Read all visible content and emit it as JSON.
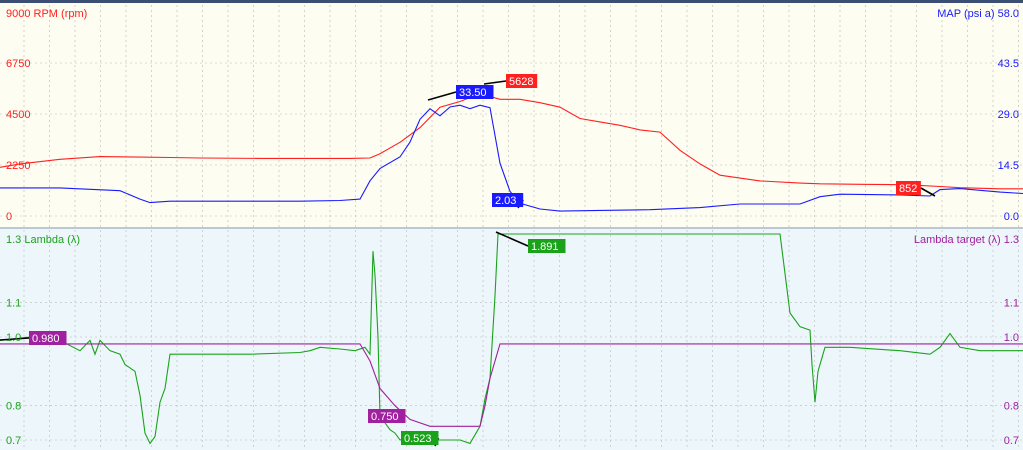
{
  "colors": {
    "rpm": "#ff2020",
    "map": "#1a1aff",
    "lambda": "#1aa31a",
    "lambda_target": "#a0209f",
    "marker": "#000000",
    "top_bg": "#fdfdf2",
    "bottom_bg": "#edf7fb",
    "grid": "#b8b8b8"
  },
  "chart_data": [
    {
      "type": "line",
      "axes": {
        "left": {
          "label": "9000 RPM (rpm)",
          "ticks": [
            "6750",
            "4500",
            "2250",
            "0"
          ],
          "range": [
            0,
            9000
          ]
        },
        "right": {
          "label": "MAP (psi a) 58.0",
          "ticks": [
            "43.5",
            "29.0",
            "14.5",
            "0.0"
          ],
          "range": [
            0,
            58
          ]
        }
      },
      "series": [
        {
          "name": "RPM",
          "axis": "left",
          "x": [
            0,
            20,
            60,
            100,
            140,
            170,
            200,
            260,
            300,
            330,
            350,
            360,
            370,
            380,
            400,
            420,
            440,
            460,
            480,
            500,
            520,
            540,
            560,
            580,
            600,
            620,
            640,
            660,
            680,
            700,
            720,
            760,
            800,
            820,
            860,
            900,
            920,
            940,
            960,
            1000,
            1023
          ],
          "y": [
            2150,
            2300,
            2500,
            2620,
            2600,
            2580,
            2560,
            2540,
            2540,
            2540,
            2540,
            2550,
            2560,
            2750,
            3250,
            3900,
            4800,
            5050,
            5400,
            5150,
            5150,
            5000,
            4800,
            4300,
            4150,
            4000,
            3800,
            3700,
            2900,
            2300,
            1800,
            1550,
            1450,
            1420,
            1400,
            1380,
            1350,
            1300,
            1250,
            1200,
            1200
          ]
        },
        {
          "name": "MAP",
          "axis": "right",
          "x": [
            0,
            60,
            120,
            140,
            150,
            170,
            200,
            250,
            300,
            340,
            360,
            370,
            380,
            400,
            410,
            420,
            430,
            440,
            450,
            460,
            470,
            480,
            490,
            500,
            510,
            520,
            540,
            560,
            600,
            650,
            700,
            740,
            800,
            820,
            840,
            900,
            930,
            940,
            960,
            1000,
            1023
          ],
          "y": [
            8,
            8,
            7.2,
            4.8,
            3.8,
            4.2,
            4.2,
            4.2,
            4.2,
            4.4,
            4.8,
            10,
            13.5,
            16.8,
            21,
            27.5,
            30.5,
            28.5,
            31,
            31.5,
            30.5,
            31.5,
            30.8,
            15,
            7,
            3.6,
            2.0,
            1.4,
            1.6,
            1.8,
            2.4,
            3.4,
            3.4,
            5.5,
            6.2,
            6.0,
            5.7,
            7.5,
            7.8,
            6.8,
            6.4
          ]
        }
      ],
      "markers": [
        {
          "series": "MAP",
          "label": "33.50"
        },
        {
          "series": "RPM",
          "label": "5628"
        },
        {
          "series": "MAP",
          "label": "2.03"
        },
        {
          "series": "RPM",
          "label": "852"
        }
      ]
    },
    {
      "type": "line",
      "axes": {
        "left": {
          "label": "1.3 Lambda (λ)",
          "ticks": [
            "1.1",
            "1.0",
            "0.8",
            "0.7"
          ],
          "range": [
            0.7,
            1.3
          ]
        },
        "right": {
          "label": "Lambda target (λ) 1.3",
          "ticks": [
            "1.1",
            "1.0",
            "0.8",
            "0.7"
          ],
          "range": [
            0.7,
            1.3
          ]
        }
      },
      "series": [
        {
          "name": "Lambda",
          "axis": "left",
          "x": [
            0,
            30,
            60,
            80,
            90,
            95,
            100,
            110,
            120,
            125,
            135,
            140,
            145,
            150,
            155,
            160,
            165,
            170,
            175,
            200,
            250,
            300,
            310,
            320,
            340,
            355,
            365,
            370,
            373,
            375,
            378,
            380,
            385,
            390,
            395,
            400,
            410,
            420,
            430,
            440,
            450,
            460,
            470,
            480,
            485,
            490,
            495,
            498,
            500,
            600,
            700,
            780,
            790,
            800,
            810,
            812,
            815,
            818,
            825,
            850,
            900,
            930,
            940,
            950,
            960,
            980,
            1000,
            1023
          ],
          "y": [
            0.99,
            1.0,
            0.99,
            0.96,
            0.99,
            0.95,
            0.99,
            0.96,
            0.95,
            0.92,
            0.9,
            0.83,
            0.72,
            0.69,
            0.71,
            0.81,
            0.85,
            0.95,
            0.95,
            0.95,
            0.95,
            0.955,
            0.96,
            0.97,
            0.965,
            0.96,
            0.97,
            0.95,
            1.25,
            1.18,
            1.0,
            0.77,
            0.75,
            0.73,
            0.72,
            0.7,
            0.71,
            0.7,
            0.7,
            0.7,
            0.7,
            0.7,
            0.69,
            0.74,
            0.82,
            0.88,
            1.12,
            1.3,
            1.3,
            1.3,
            1.3,
            1.3,
            1.07,
            1.03,
            1.02,
            0.92,
            0.81,
            0.9,
            0.97,
            0.97,
            0.96,
            0.95,
            0.97,
            1.01,
            0.97,
            0.96,
            0.96,
            0.96
          ]
        },
        {
          "name": "Lambda target",
          "axis": "right",
          "x": [
            0,
            30,
            60,
            360,
            370,
            380,
            395,
            410,
            430,
            450,
            480,
            485,
            490,
            497,
            500,
            520,
            700,
            900,
            1023
          ],
          "y": [
            0.98,
            0.98,
            0.98,
            0.98,
            0.93,
            0.85,
            0.8,
            0.76,
            0.74,
            0.74,
            0.74,
            0.8,
            0.88,
            0.95,
            0.98,
            0.98,
            0.98,
            0.98,
            0.98
          ]
        }
      ],
      "markers": [
        {
          "series": "Lambda target",
          "label": "0.980"
        },
        {
          "series": "Lambda target",
          "label": "0.750"
        },
        {
          "series": "Lambda",
          "label": "0.523"
        },
        {
          "series": "Lambda",
          "label": "1.891"
        }
      ]
    }
  ]
}
